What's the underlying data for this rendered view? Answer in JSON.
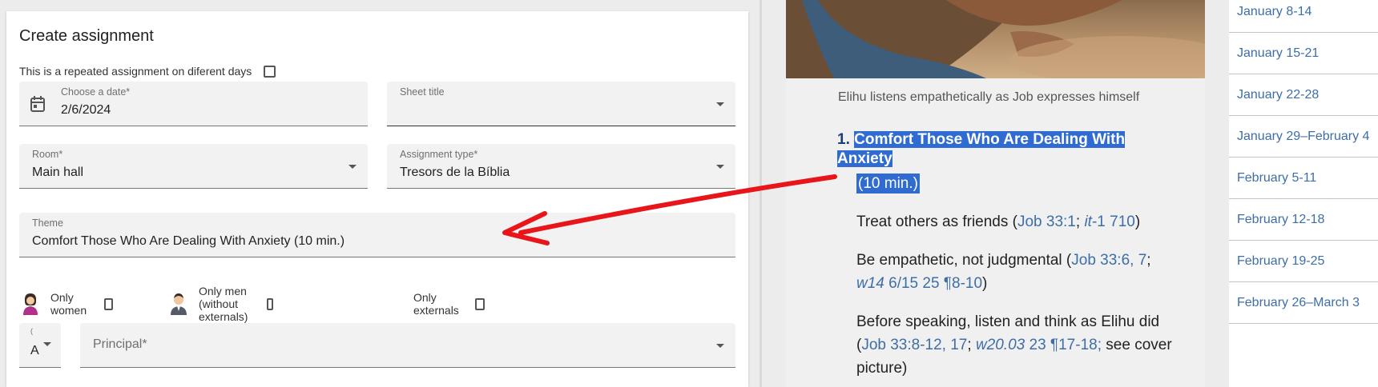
{
  "form": {
    "title": "Create assignment",
    "repeat_label": "This is a repeated assignment on diferent days",
    "date": {
      "label": "Choose a date*",
      "value": "2/6/2024"
    },
    "sheet_title": {
      "label": "Sheet title",
      "value": ""
    },
    "room": {
      "label": "Room*",
      "value": "Main hall"
    },
    "assignment_type": {
      "label": "Assignment type*",
      "value": "Tresors de la Bíblia"
    },
    "theme": {
      "label": "Theme",
      "value": "Comfort Those Who Are Dealing With Anxiety (10 min.)"
    },
    "filters": {
      "only_women": "Only women",
      "only_men": "Only men (without externals)",
      "only_externals": "Only externals"
    },
    "small_select": {
      "label": "(",
      "value": "A"
    },
    "principal": {
      "label": "Principal*"
    }
  },
  "reading": {
    "caption": "Elihu listens empathetically as Job expresses himself",
    "point_number": "1.",
    "point_title": "Comfort Those Who Are Dealing With Anxiety",
    "duration": "(10 min.)",
    "bullet1": {
      "text": "Treat others as friends (",
      "ref1": "Job 33:1",
      "sep": "; ",
      "ref2_ital": "it",
      "ref2_rest": "-1 710",
      "end": ")"
    },
    "bullet2": {
      "text": "Be empathetic, not judgmental (",
      "ref1": "Job 33:6, 7",
      "sep": "; ",
      "ref2_ital": "w14",
      "ref2_rest": " 6/15 25 ¶8-10",
      "end": ")"
    },
    "bullet3": {
      "text": "Before speaking, listen and think as Elihu did (",
      "ref1": "Job 33:8-12, 17",
      "sep": "; ",
      "ref2_ital": "w20.03",
      "ref2_rest": " 23 ¶17-18;",
      "end": " see cover picture)"
    }
  },
  "nav": [
    "January 8-14",
    "January 15-21",
    "January 22-28",
    "January 29–February 4",
    "February 5-11",
    "February 12-18",
    "February 19-25",
    "February 26–March 3"
  ],
  "colors": {
    "highlight": "#2f6bd0",
    "link": "#3d6ea8",
    "arrow": "#e8151a"
  }
}
